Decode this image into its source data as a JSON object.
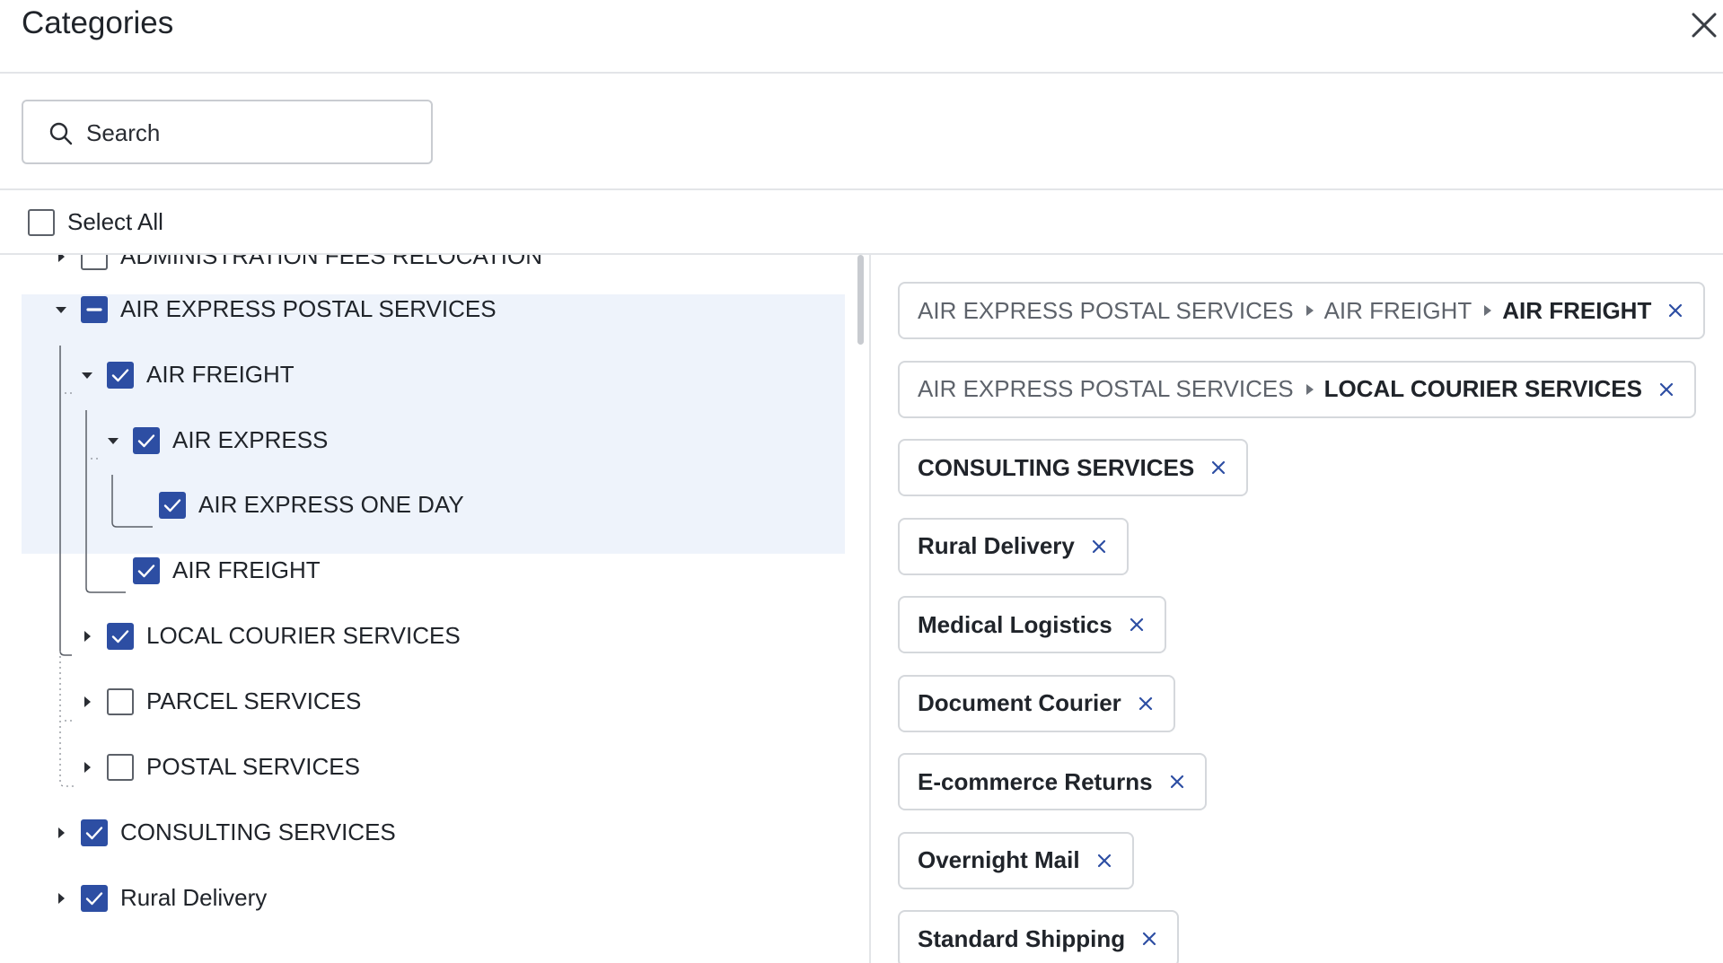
{
  "dialog": {
    "title": "Categories"
  },
  "search": {
    "placeholder": "Search",
    "value": ""
  },
  "select_all": {
    "label": "Select All",
    "checked": false
  },
  "tree": [
    {
      "label": "ADMINISTRATION FEES RELOCATION",
      "state": "unchecked",
      "expanded": false
    },
    {
      "label": "AIR EXPRESS POSTAL SERVICES",
      "state": "indeterminate",
      "expanded": true
    },
    {
      "label": "AIR FREIGHT",
      "state": "checked",
      "expanded": true
    },
    {
      "label": "AIR EXPRESS",
      "state": "checked",
      "expanded": true
    },
    {
      "label": "AIR EXPRESS ONE DAY",
      "state": "checked",
      "expanded": false
    },
    {
      "label": "AIR  FREIGHT",
      "state": "checked",
      "expanded": false
    },
    {
      "label": "LOCAL COURIER SERVICES",
      "state": "checked",
      "expanded": false
    },
    {
      "label": "PARCEL SERVICES",
      "state": "unchecked",
      "expanded": false
    },
    {
      "label": "POSTAL SERVICES",
      "state": "unchecked",
      "expanded": false
    },
    {
      "label": "CONSULTING SERVICES",
      "state": "checked",
      "expanded": false
    },
    {
      "label": "Rural Delivery",
      "state": "checked",
      "expanded": false
    }
  ],
  "selected_chips": [
    {
      "path": [
        "AIR EXPRESS POSTAL SERVICES",
        "AIR FREIGHT",
        "AIR FREIGHT"
      ]
    },
    {
      "path": [
        "AIR EXPRESS POSTAL SERVICES",
        "LOCAL COURIER SERVICES"
      ]
    },
    {
      "path": [
        "CONSULTING SERVICES"
      ]
    },
    {
      "path": [
        "Rural Delivery"
      ]
    },
    {
      "path": [
        "Medical Logistics"
      ]
    },
    {
      "path": [
        "Document Courier"
      ]
    },
    {
      "path": [
        "E-commerce Returns"
      ]
    },
    {
      "path": [
        "Overnight Mail"
      ]
    },
    {
      "path": [
        "Standard Shipping"
      ]
    }
  ],
  "colors": {
    "accent": "#2d4ea3",
    "highlight": "#eef3fb",
    "border": "#d5d8dc"
  },
  "icons": {
    "close": "close-icon",
    "search": "search-icon",
    "expand": "caret-right-icon",
    "collapse": "caret-down-icon",
    "chip_remove": "remove-chip-icon"
  }
}
